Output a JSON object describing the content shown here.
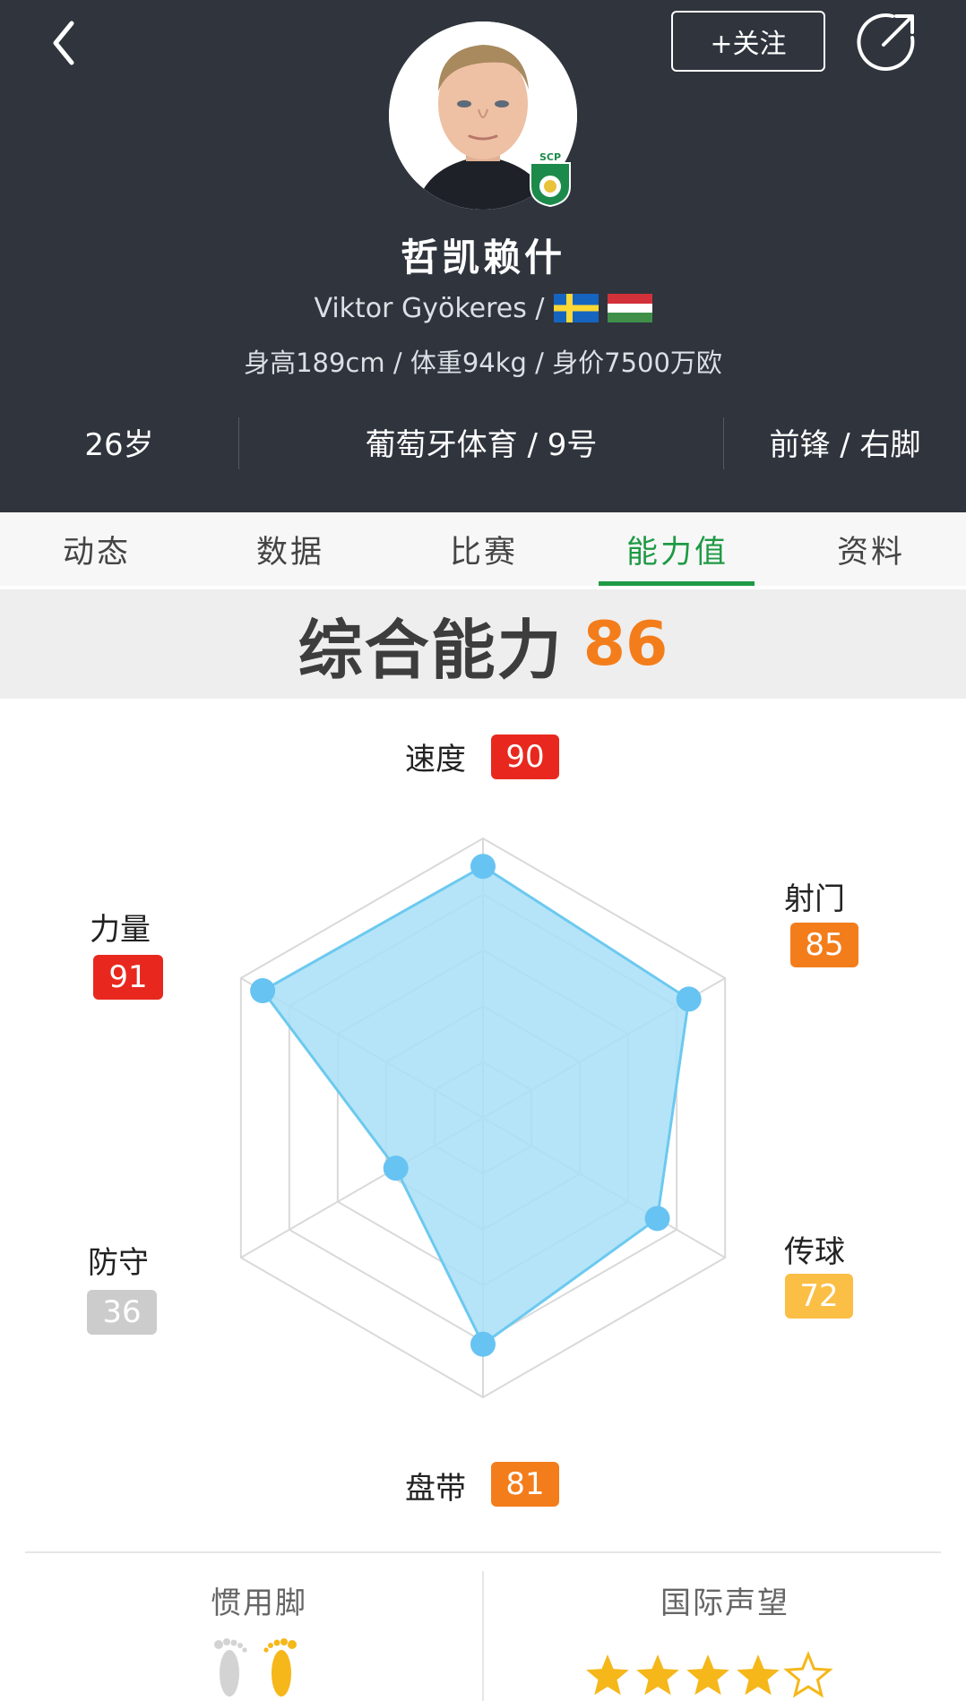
{
  "header": {
    "follow_label": "+关注",
    "name_cn": "哲凯赖什",
    "name_en": "Viktor Gyökeres /",
    "stats": "身高189cm / 体重94kg / 身价7500万欧",
    "age": "26岁",
    "club_number": "葡萄牙体育 / 9号",
    "position_foot": "前锋 / 右脚",
    "badge_text": "SCP",
    "icons": [
      "back-icon",
      "share-icon",
      "sweden-flag-icon",
      "hungary-flag-icon"
    ]
  },
  "tabs": [
    {
      "label": "动态",
      "active": false
    },
    {
      "label": "数据",
      "active": false
    },
    {
      "label": "比赛",
      "active": false
    },
    {
      "label": "能力值",
      "active": true
    },
    {
      "label": "资料",
      "active": false
    }
  ],
  "overall": {
    "label": "综合能力",
    "value": "86"
  },
  "radar": {
    "attributes": [
      {
        "label": "速度",
        "value": 90,
        "color": "#e8281e"
      },
      {
        "label": "射门",
        "value": 85,
        "color": "#f47d1b"
      },
      {
        "label": "传球",
        "value": 72,
        "color": "#fbbf45"
      },
      {
        "label": "盘带",
        "value": 81,
        "color": "#f47d1b"
      },
      {
        "label": "防守",
        "value": 36,
        "color": "#cccccc"
      },
      {
        "label": "力量",
        "value": 91,
        "color": "#e8281e"
      }
    ],
    "max": 100,
    "fill_color": "#a8dff7",
    "stroke_color": "#6cc9ef",
    "point_color": "#67c3f2"
  },
  "bottom": {
    "preferred_foot_label": "惯用脚",
    "preferred_foot": "right",
    "reputation_label": "国际声望",
    "reputation_stars": 4,
    "reputation_max": 5,
    "star_color": "#f5b71a"
  },
  "colors": {
    "header_bg": "#2f343d",
    "accent_green": "#1f9a45",
    "overall_orange": "#f47d1b"
  }
}
